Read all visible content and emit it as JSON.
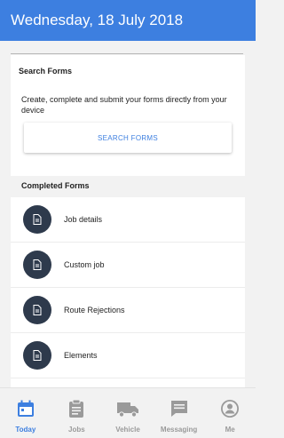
{
  "header": {
    "date": "Wednesday, 18 July 2018"
  },
  "search": {
    "title": "Search Forms",
    "description": "Create, complete and submit your forms directly from your device",
    "button_label": "SEARCH FORMS"
  },
  "completed": {
    "title": "Completed Forms",
    "items": [
      {
        "label": "Job details",
        "icon": "document-icon"
      },
      {
        "label": "Custom job",
        "icon": "document-icon"
      },
      {
        "label": "Route Rejections",
        "icon": "document-icon"
      },
      {
        "label": "Elements",
        "icon": "document-icon"
      }
    ]
  },
  "tabs": [
    {
      "label": "Today",
      "icon": "calendar-icon",
      "active": true
    },
    {
      "label": "Jobs",
      "icon": "clipboard-icon",
      "active": false
    },
    {
      "label": "Vehicle",
      "icon": "truck-icon",
      "active": false
    },
    {
      "label": "Messaging",
      "icon": "message-icon",
      "active": false
    },
    {
      "label": "Me",
      "icon": "profile-icon",
      "active": false
    }
  ],
  "colors": {
    "primary": "#3d7fe0",
    "form_icon_bg": "#2e3a4c",
    "tab_inactive": "#9a9a9a"
  }
}
